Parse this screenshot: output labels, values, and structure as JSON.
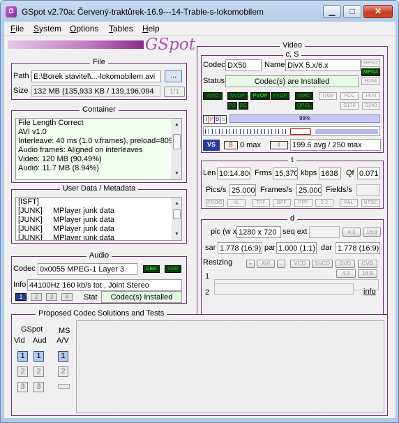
{
  "window": {
    "title": "GSpot v2.70a: Červený-traktůrek-16.9---14-Trable-s-lokomobilem",
    "icon": "gspot-app-icon"
  },
  "menu": [
    {
      "accel": "F",
      "rest": "ile"
    },
    {
      "accel": "S",
      "rest": "ystem"
    },
    {
      "accel": "O",
      "rest": "ptions"
    },
    {
      "accel": "T",
      "rest": "ables"
    },
    {
      "accel": "H",
      "rest": "elp"
    }
  ],
  "logo": "GSpot",
  "file": {
    "title": "File",
    "path_label": "Path",
    "path": "E:\\Borek stavitel\\...-lokomobilem.avi",
    "browse": "...",
    "size_label": "Size",
    "size": "132 MB (135,933 KB / 139,196,094",
    "page": "1/1"
  },
  "container": {
    "title": "Container",
    "lines": [
      "File Length Correct",
      "AVI v1.0",
      "Interleave: 40 ms (1.0 v.frames), preload=809",
      "Audio frames: Aligned on interleaves",
      "Video: 120 MB (90.49%)",
      "Audio: 11.7 MB (8.94%)"
    ]
  },
  "userdata": {
    "title": "User Data / Metadata",
    "rows": [
      [
        "[ISFT]",
        ""
      ],
      [
        "[JUNK]",
        "MPlayer junk data"
      ],
      [
        "[JUNK]",
        "MPlayer junk data"
      ],
      [
        "[JUNK]",
        "MPlayer junk data"
      ],
      [
        "[JUNK]",
        "MPlayer junk data"
      ]
    ]
  },
  "audio": {
    "title": "Audio",
    "codec_label": "Codec",
    "codec": "0x0055  MPEG-1 Layer 3",
    "cbr": "CBR",
    "vbr": "VBR",
    "info_label": "Info",
    "info": "44100Hz  160 kb/s tot , Joint Stereo",
    "streams": [
      "1",
      "2",
      "3",
      "4"
    ],
    "stat_label": "Stat",
    "stat": "Codec(s) Installed"
  },
  "video": {
    "title": "Video",
    "cs_title": "c, S",
    "codec_label": "Codec",
    "codec": "DX50",
    "name_label": "Name",
    "name": "DivX 5.x/6.x",
    "status_label": "Status",
    "status": "Codec(s) are Installed",
    "side_leds": [
      "MPG2",
      "MPG4",
      "H264"
    ],
    "flags_row1": [
      "AVID",
      "NVOP",
      "PVOP",
      "FVOP"
    ],
    "flags_row2": [
      "PS",
      "DC"
    ],
    "smc": "SMC",
    "qpel": "QPEL",
    "std_leds": [
      "I709",
      "FCC",
      "I470",
      "S170",
      "S240"
    ],
    "ipbs": [
      "I",
      "P",
      "B",
      "S"
    ],
    "percent": "99%",
    "b_max": "0 max",
    "i_avg": "199.6 avg / 250 max",
    "t_title": "t",
    "len_label": "Len",
    "len": "10:14.800",
    "frms_label": "Frms",
    "frms": "15,370",
    "kbps_label": "kbps",
    "kbps": "1638",
    "qf_label": "Qf",
    "qf": "0.071",
    "pics_label": "Pics/s",
    "pics": "25.000",
    "frames_label": "Frames/s",
    "frames": "25.000",
    "fields_label": "Fields/s",
    "fields": "",
    "mode_leds": [
      "PROG",
      "I/L",
      "TFF",
      "BFF",
      "PPF",
      "3:2",
      "PAL",
      "NTSC"
    ],
    "d_title": "d",
    "pic_label": "pic (w x",
    "pic": "1280 x 720",
    "seqext_label": "seq ext",
    "seqext": "",
    "ar_btns": [
      "4:3",
      "16:9"
    ],
    "sar_label": "sar",
    "sar": "1.778 (16:9)",
    "par_label": "par",
    "par": "1.000 (1:1)",
    "dar_label": "dar",
    "dar": "1.778 (16:9)",
    "resizing_label": "Resizing",
    "plus": "+",
    "avi": "AVI",
    "minus": "-",
    "resize_btns": [
      "VCD",
      "SVCD",
      "DVD",
      "CVD"
    ],
    "r1_label": "1",
    "r2_label": "2",
    "r1_btns": [
      "4:3",
      "16:9"
    ],
    "info_link": "info"
  },
  "codecs": {
    "title": "Proposed Codec Solutions and Tests",
    "gspot": "GSpot",
    "vid": "Vid",
    "aud": "Aud",
    "ms": "MS",
    "av": "A/V",
    "nums": [
      "1",
      "2",
      "3"
    ]
  },
  "colors": {
    "frame": "#722a72",
    "led_on": "#30ff30",
    "accent": "#b050b0"
  }
}
